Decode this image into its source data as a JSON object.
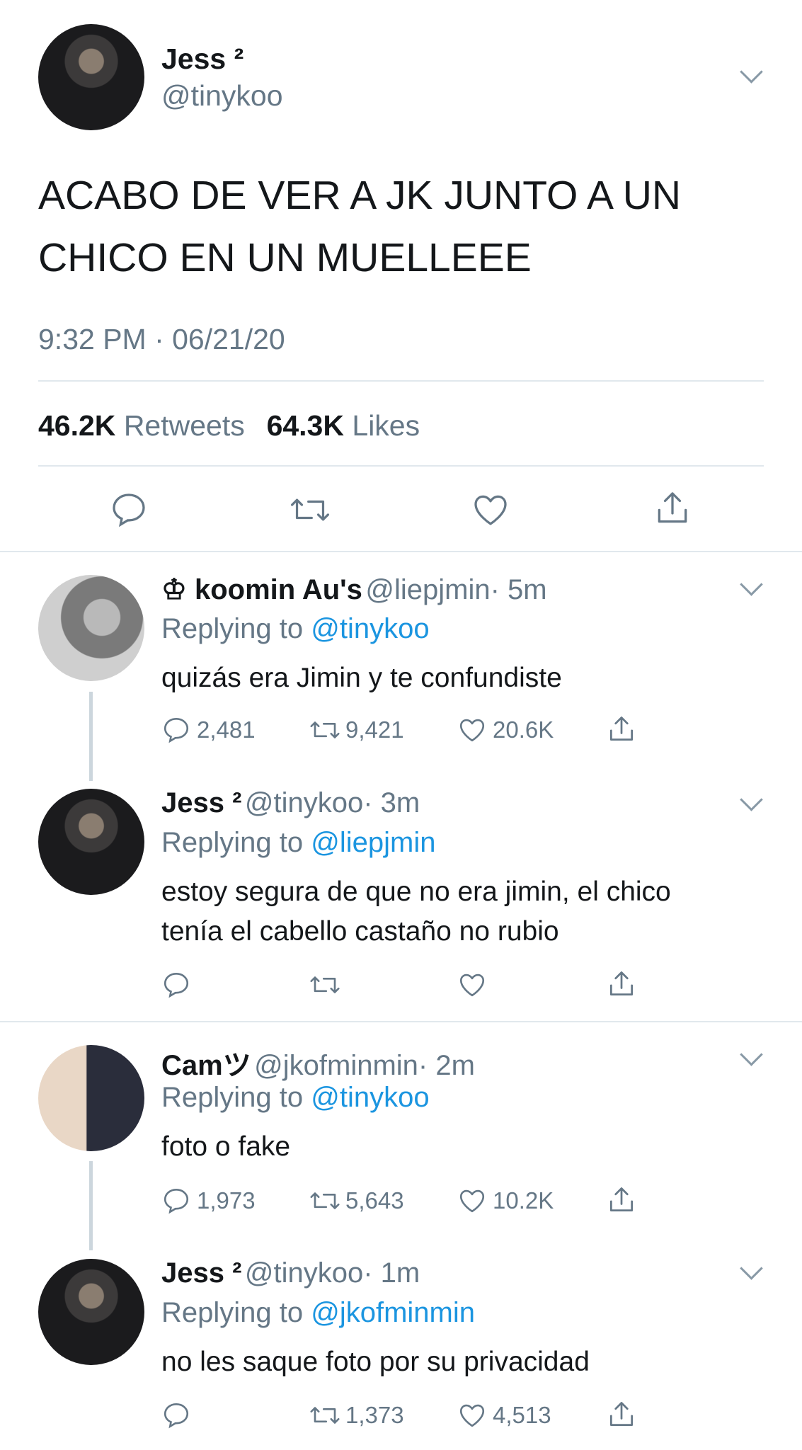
{
  "main_tweet": {
    "name": "Jess ²",
    "handle": "@tinykoo",
    "text_line1": "ACABO DE VER A JK JUNTO A UN",
    "text_line2": "CHICO EN UN MUELLEEE",
    "timestamp": "9:32 PM · 06/21/20",
    "retweets_count": "46.2K",
    "retweets_label": "Retweets",
    "likes_count": "64.3K",
    "likes_label": "Likes"
  },
  "replies": [
    {
      "name": "♔ koomin Au's",
      "handle": "@liepjmin",
      "time": "· 5m",
      "replying_prefix": "Replying to",
      "replying_to": "@tinykoo",
      "text": "quizás era Jimin y te confundiste",
      "replies": "2,481",
      "retweets": "9,421",
      "likes": "20.6K"
    },
    {
      "name": "Jess ²",
      "handle": "@tinykoo",
      "time": "· 3m",
      "replying_prefix": "Replying to",
      "replying_to": "@liepjmin",
      "text_line1": "estoy segura de que no era jimin, el chico",
      "text_line2": "tenía el cabello castaño no rubio"
    },
    {
      "name": "Camツ",
      "handle": "@jkofminmin",
      "time": "· 2m",
      "replying_prefix": "Replying to",
      "replying_to": "@tinykoo",
      "text": "foto o fake",
      "replies": "1,973",
      "retweets": "5,643",
      "likes": "10.2K"
    },
    {
      "name": "Jess ²",
      "handle": "@tinykoo",
      "time": "· 1m",
      "replying_prefix": "Replying to",
      "replying_to": "@jkofminmin",
      "text": "no les saque foto por su privacidad",
      "retweets": "1,373",
      "likes": "4,513"
    }
  ],
  "colors": {
    "text": "#14171a",
    "secondary": "#657786",
    "link": "#1b95e0",
    "divider": "#e1e8ed"
  }
}
